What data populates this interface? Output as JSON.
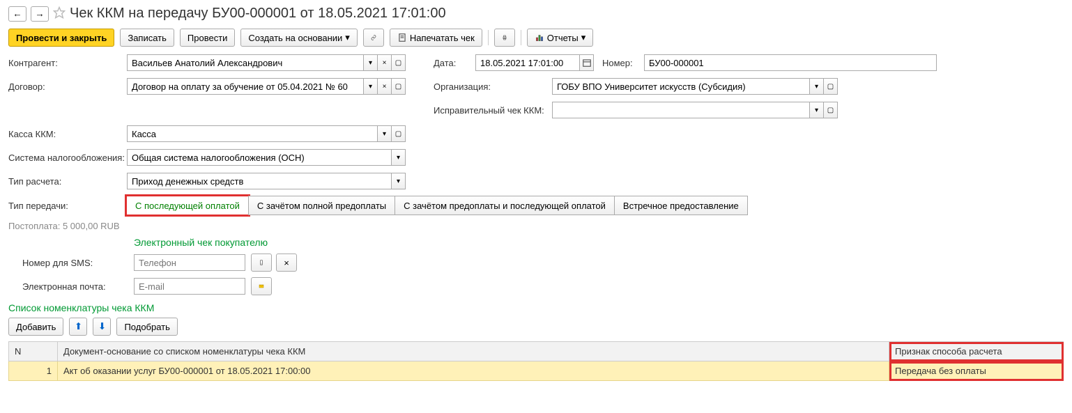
{
  "header": {
    "title": "Чек ККМ на передачу БУ00-000001 от 18.05.2021 17:01:00"
  },
  "toolbar": {
    "post_close": "Провести и закрыть",
    "save": "Записать",
    "post": "Провести",
    "create_based": "Создать на основании",
    "print_check": "Напечатать чек",
    "reports": "Отчеты"
  },
  "left": {
    "counterparty_label": "Контрагент:",
    "counterparty_value": "Васильев Анатолий Александрович",
    "contract_label": "Договор:",
    "contract_value": "Договор на оплату за обучение от 05.04.2021 № 60",
    "kkm_label": "Касса ККМ:",
    "kkm_value": "Касса",
    "tax_label": "Система налогообложения:",
    "tax_value": "Общая система налогообложения (ОСН)",
    "calc_type_label": "Тип расчета:",
    "calc_type_value": "Приход денежных средств",
    "transfer_type_label": "Тип передачи:",
    "transfer_options": [
      "С последующей оплатой",
      "С зачётом полной предоплаты",
      "С зачётом предоплаты и последующей оплатой",
      "Встречное предоставление"
    ],
    "postpay": "Постоплата: 5 000,00 RUB"
  },
  "right": {
    "date_label": "Дата:",
    "date_value": "18.05.2021 17:01:00",
    "number_label": "Номер:",
    "number_value": "БУ00-000001",
    "org_label": "Организация:",
    "org_value": "ГОБУ ВПО Университет искусств (Субсидия)",
    "corr_label": "Исправительный чек ККМ:",
    "corr_value": ""
  },
  "echeck": {
    "title": "Электронный чек покупателю",
    "sms_label": "Номер для SMS:",
    "sms_placeholder": "Телефон",
    "email_label": "Электронная почта:",
    "email_placeholder": "E-mail"
  },
  "list": {
    "title": "Список номенклатуры чека ККМ",
    "add": "Добавить",
    "pick": "Подобрать",
    "col_n": "N",
    "col_doc": "Документ-основание со списком номенклатуры чека ККМ",
    "col_sign": "Признак способа расчета",
    "rows": [
      {
        "n": "1",
        "doc": "Акт об оказании услуг БУ00-000001 от 18.05.2021 17:00:00",
        "sign": "Передача без оплаты"
      }
    ]
  }
}
